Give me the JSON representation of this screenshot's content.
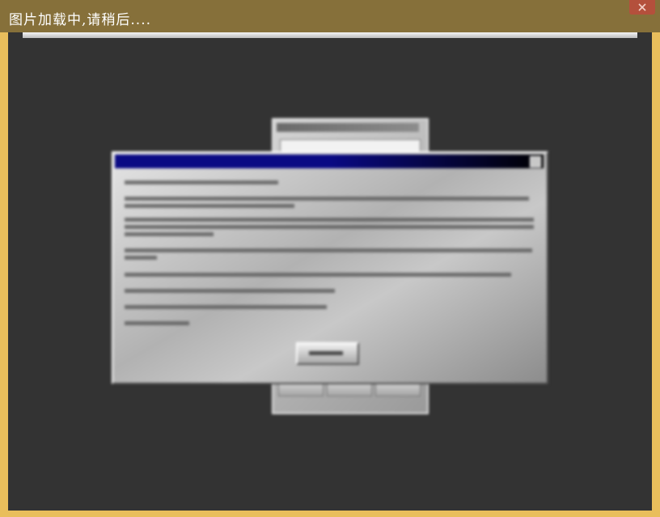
{
  "viewer": {
    "title": "图片加载中,请稍后....",
    "close_icon": "close-icon"
  },
  "colors": {
    "frame": "#e9be5c",
    "title_bar": "#86703a",
    "stage": "#333333",
    "close_button": "#b4503c",
    "dialog_title_bar": "#0a0a84"
  }
}
